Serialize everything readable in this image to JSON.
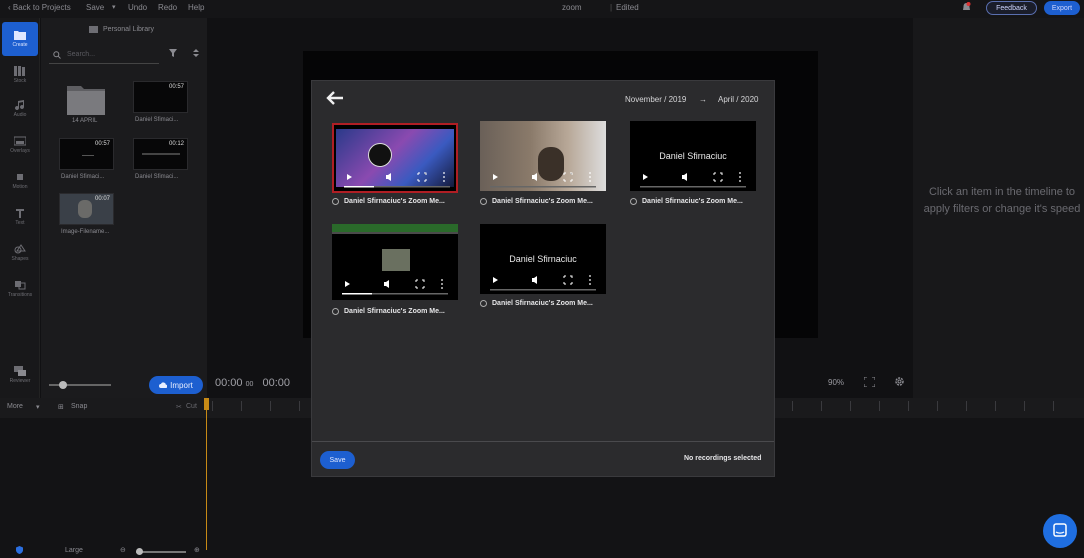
{
  "topbar": {
    "back": "‹  Back to Projects",
    "save": "Save",
    "undo": "Undo",
    "redo": "Redo",
    "help": "Help",
    "project": "zoom",
    "status": "Edited",
    "feedback": "Feedback",
    "export": "Export"
  },
  "rail": [
    {
      "label": "Create",
      "icon": "folder-icon"
    },
    {
      "label": "Stock",
      "icon": "stock-icon"
    },
    {
      "label": "Audio",
      "icon": "music-icon"
    },
    {
      "label": "Overlays",
      "icon": "overlay-icon"
    },
    {
      "label": "Motion",
      "icon": "motion-icon"
    },
    {
      "label": "Text",
      "icon": "text-icon"
    },
    {
      "label": "Shapes",
      "icon": "shapes-icon"
    },
    {
      "label": "Transitions",
      "icon": "transitions-icon"
    },
    {
      "label": "Reviewer",
      "icon": "reviewer-icon"
    }
  ],
  "library": {
    "title": "Personal Library",
    "search_placeholder": "Search...",
    "items": [
      {
        "label": "14 APRIL",
        "duration": ""
      },
      {
        "label": "Daniel Sfimaci...",
        "duration": "00:57"
      },
      {
        "label": "Daniel Sfimaci...",
        "duration": "00:57"
      },
      {
        "label": "Daniel Sfimaci...",
        "duration": "00:12"
      },
      {
        "label": "Image-Filename...",
        "duration": "00:07"
      }
    ],
    "import": "Import"
  },
  "player": {
    "time_current": "00:00",
    "time_current_frac": "00",
    "time_total": "00:00",
    "zoom": "90%"
  },
  "rightpane": {
    "hint": "Click an item in the timeline to apply filters or change it's speed"
  },
  "timeline": {
    "more": "More",
    "snap": "Snap",
    "cut": "Cut",
    "size": "Large"
  },
  "modal": {
    "date_from": "November / 2019",
    "date_to": "April / 2020",
    "recordings": [
      {
        "label": "Daniel Sfirnaciuc's Zoom Me...",
        "overlay_text": ""
      },
      {
        "label": "Daniel Sfirnaciuc's Zoom Me...",
        "overlay_text": ""
      },
      {
        "label": "Daniel Sfirnaciuc's Zoom Me...",
        "overlay_text": "Daniel Sfirnaciuc"
      },
      {
        "label": "Daniel Sfirnaciuc's Zoom Me...",
        "overlay_text": ""
      },
      {
        "label": "Daniel Sfirnaciuc's Zoom Me...",
        "overlay_text": "Daniel Sfirnaciuc"
      }
    ],
    "save": "Save",
    "status": "No recordings selected"
  },
  "colors": {
    "accent": "#1d5fd0",
    "bg": "#111113",
    "modal": "#2b2b2d"
  }
}
